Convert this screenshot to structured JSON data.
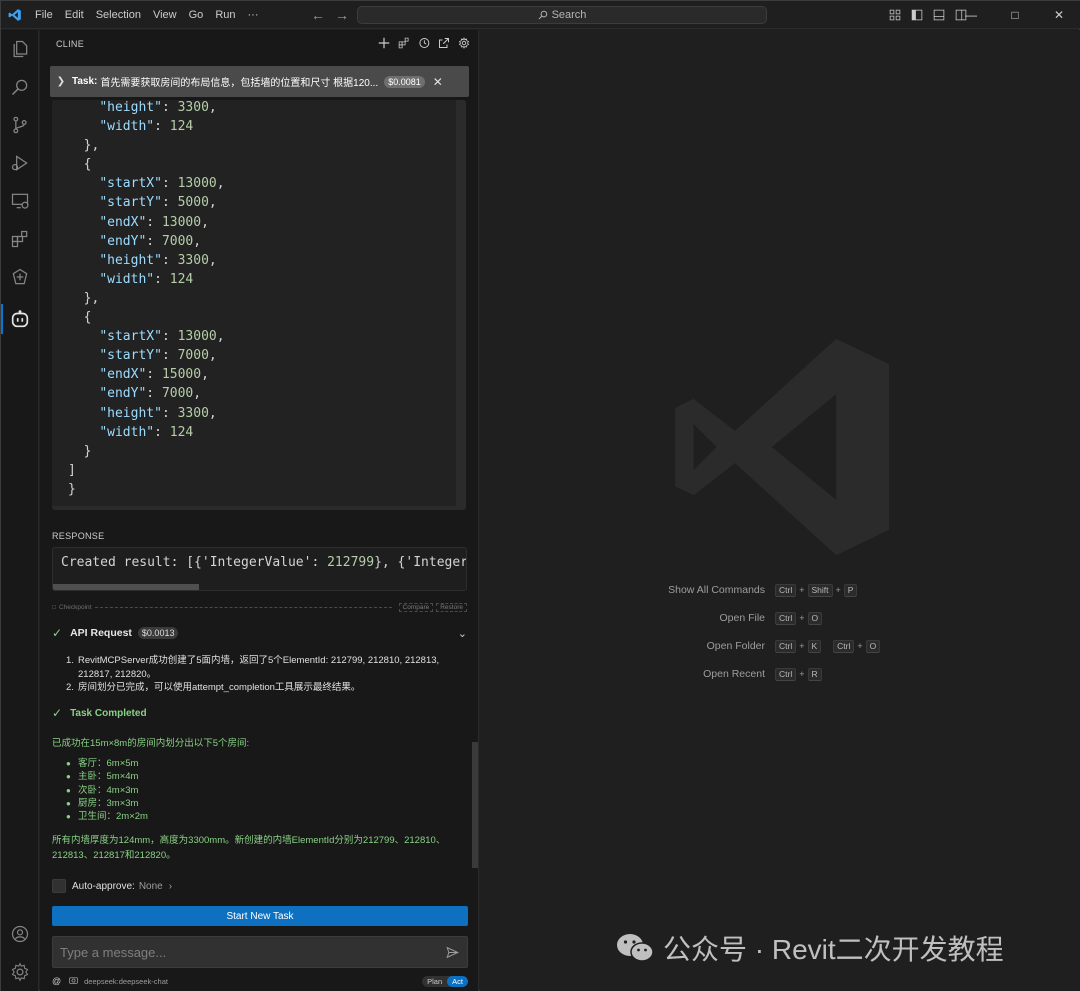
{
  "titlebar": {
    "menus": [
      "File",
      "Edit",
      "Selection",
      "View",
      "Go",
      "Run",
      "···"
    ],
    "search_placeholder": "Search"
  },
  "activitybar": {
    "icons": [
      "explorer-icon",
      "search-icon",
      "source-control-icon",
      "run-debug-icon",
      "remote-explorer-icon",
      "extensions-icon",
      "tree-sitter-icon",
      "cline-icon"
    ],
    "bottom_icons": [
      "account-icon",
      "manage-gear-icon"
    ]
  },
  "cline": {
    "title": "CLINE",
    "task": {
      "label": "Task:",
      "text": "首先需要获取房间的布局信息，包括墙的位置和尺寸 根据120...",
      "cost": "$0.0081"
    },
    "code_lines": [
      "    \"height\": 3300,",
      "    \"width\": 124",
      "  },",
      "  {",
      "    \"startX\": 13000,",
      "    \"startY\": 5000,",
      "    \"endX\": 13000,",
      "    \"endY\": 7000,",
      "    \"height\": 3300,",
      "    \"width\": 124",
      "  },",
      "  {",
      "    \"startX\": 13000,",
      "    \"startY\": 7000,",
      "    \"endX\": 15000,",
      "    \"endY\": 7000,",
      "    \"height\": 3300,",
      "    \"width\": 124",
      "  }",
      "]",
      "}"
    ],
    "response_label": "RESPONSE",
    "response_text_prefix": "Created result: [{'IntegerValue': ",
    "response_number": "212799",
    "response_text_suffix": "}, {'Integer",
    "checkpoint": {
      "label": "Checkpoint",
      "compare": "Compare",
      "restore": "Restore"
    },
    "api_request": {
      "label": "API Request",
      "cost": "$0.0013"
    },
    "api_list": [
      {
        "num": "1.",
        "text": "RevitMCPServer成功创建了5面内墙，返回了5个ElementId: 212799, 212810, 212813, 212817, 212820。"
      },
      {
        "num": "2.",
        "text": "房间划分已完成，可以使用attempt_completion工具展示最终结果。"
      }
    ],
    "task_completed_label": "Task Completed",
    "completed_intro": "已成功在15m×8m的房间内划分出以下5个房间:",
    "rooms": [
      "客厅：6m×5m",
      "主卧：5m×4m",
      "次卧：4m×3m",
      "厨房：3m×3m",
      "卫生间：2m×2m"
    ],
    "completed_summary": "所有内墙厚度为124mm，高度为3300mm。新创建的内墙ElementId分别为212799、212810、212813、212817和212820。",
    "auto_approve": {
      "label": "Auto-approve:",
      "value": "None"
    },
    "start_new_task": "Start New Task",
    "message_placeholder": "Type a message...",
    "model": "deepseek:deepseek-chat",
    "mode": {
      "plan": "Plan",
      "act": "Act"
    }
  },
  "editor": {
    "shortcuts": [
      {
        "label": "Show All Commands",
        "keys": [
          [
            "Ctrl",
            "Shift",
            "P"
          ]
        ]
      },
      {
        "label": "Open File",
        "keys": [
          [
            "Ctrl",
            "O"
          ]
        ]
      },
      {
        "label": "Open Folder",
        "keys": [
          [
            "Ctrl",
            "K"
          ],
          [
            "Ctrl",
            "O"
          ]
        ]
      },
      {
        "label": "Open Recent",
        "keys": [
          [
            "Ctrl",
            "R"
          ]
        ]
      }
    ],
    "watermark_text": "公众号 · Revit二次开发教程"
  },
  "colors": {
    "accent": "#0e70c0",
    "success": "#89d185",
    "json_key": "#9cdcfe",
    "json_number": "#b5cea8"
  }
}
